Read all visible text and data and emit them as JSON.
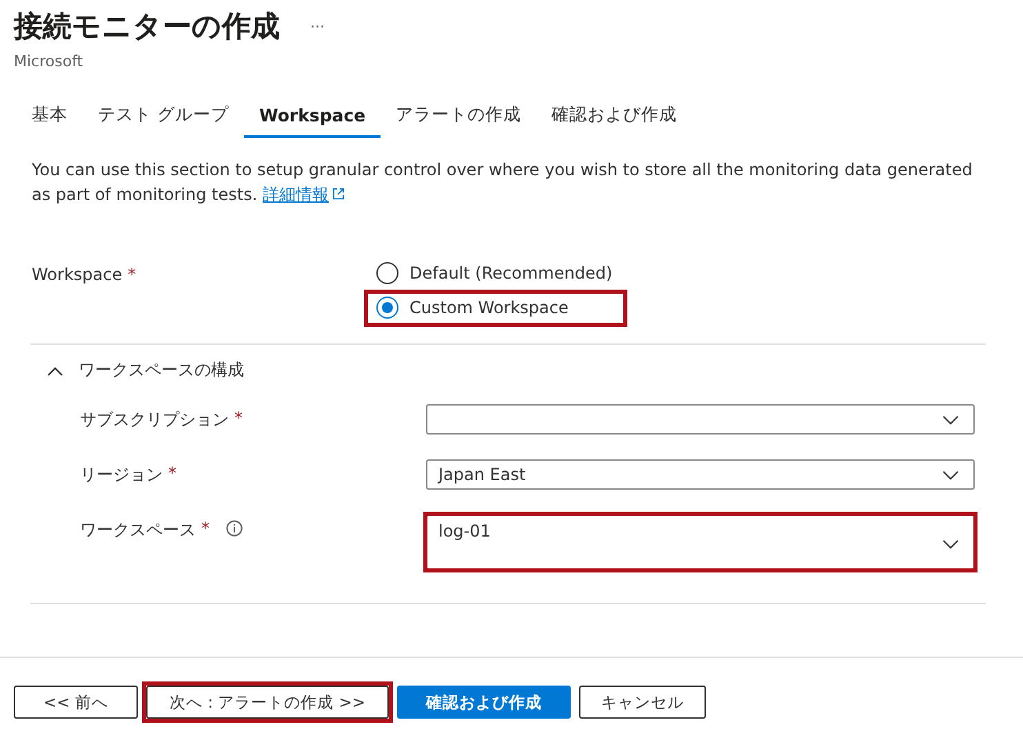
{
  "header": {
    "title": "接続モニターの作成",
    "more": "···",
    "publisher": "Microsoft"
  },
  "tabs": [
    {
      "label": "基本",
      "selected": false
    },
    {
      "label": "テスト グループ",
      "selected": false
    },
    {
      "label": "Workspace",
      "selected": true
    },
    {
      "label": "アラートの作成",
      "selected": false
    },
    {
      "label": "確認および作成",
      "selected": false
    }
  ],
  "description": {
    "text": "You can use this section to setup granular control over where you wish to store all the monitoring data generated as part of monitoring tests.",
    "link": "詳細情報"
  },
  "workspace": {
    "label": "Workspace",
    "required_mark": "*",
    "options": [
      {
        "label": "Default (Recommended)",
        "selected": false,
        "highlighted": false
      },
      {
        "label": "Custom Workspace",
        "selected": true,
        "highlighted": true
      }
    ]
  },
  "section": {
    "title": "ワークスペースの構成",
    "expanded": true,
    "fields": [
      {
        "label": "サブスクリプション",
        "required_mark": "*",
        "info": false,
        "highlighted": false
      },
      {
        "label": "リージョン",
        "required_mark": "*",
        "info": false,
        "value": "Japan East",
        "highlighted": false
      },
      {
        "label": "ワークスペース",
        "required_mark": "*",
        "info": true,
        "value": "log-01",
        "highlighted": true
      }
    ]
  },
  "buttons": [
    {
      "label": "<< 前へ",
      "kind": "secondary",
      "highlighted": false
    },
    {
      "label": "次へ : アラートの作成 >>",
      "kind": "secondary",
      "highlighted": true
    },
    {
      "label": "確認および作成",
      "kind": "primary",
      "highlighted": false
    },
    {
      "label": "キャンセル",
      "kind": "secondary",
      "highlighted": false
    }
  ]
}
